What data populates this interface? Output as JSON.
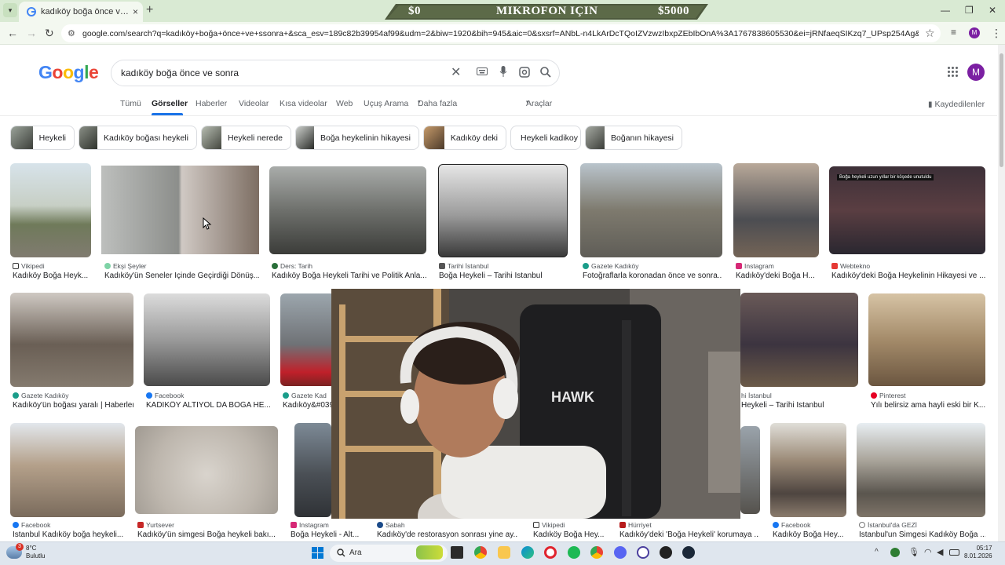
{
  "browser": {
    "tab_title": "kadıköy boğa önce ve sonra - G",
    "tab_close": "×",
    "new_tab": "+",
    "url": "google.com/search?q=kadıköy+boğa+önce+ve+ssonra+&sca_esv=189c82b39954af99&udm=2&biw=1920&bih=945&aic=0&sxsrf=ANbL-n4LkArDcTQoIZVzwzIbxpZEbIbOnA%3A1767838605530&ei=jRNfaeqSIKzq7_UPsp254Ag&ved=0ahUKEwiqjemA8PqR...",
    "profile_initial": "M"
  },
  "banner": {
    "left": "$0",
    "center": "MIKROFON IÇIN",
    "right": "$5000"
  },
  "google": {
    "logo": "Google",
    "query": "kadıköy boğa önce ve sonra",
    "avatar_initial": "M",
    "tabs": [
      "Tümü",
      "Görseller",
      "Haberler",
      "Videolar",
      "Kısa videolar",
      "Web",
      "Uçuş Arama",
      "Daha fazla"
    ],
    "tools": "Araçlar",
    "saved": "Kaydedilenler"
  },
  "chips": [
    "Heykeli",
    "Kadıköy boğası heykeli",
    "Heykeli nerede",
    "Boğa heykelinin hikayesi",
    "Kadıköy deki",
    "Heykeli kadikoy",
    "Boğanın hikayesi"
  ],
  "results": [
    {
      "source": "Vikipedi",
      "title": "Kadıköy Boğa Heyk..."
    },
    {
      "source": "Ekşi Şeyler",
      "title": "Kadıköy'ün Seneler İçinde Geçirdiği Dönüş..."
    },
    {
      "source": "Ders: Tarih",
      "title": "Kadıköy Boğa Heykeli Tarihi ve Politik Anla..."
    },
    {
      "source": "Tarihi İstanbul",
      "title": "Boğa Heykeli – Tarihi İstanbul"
    },
    {
      "source": "Gazete Kadıköy",
      "title": "Fotoğraflarla koronadan önce ve sonra..."
    },
    {
      "source": "Instagram",
      "title": "Kadıköy'deki Boğa H..."
    },
    {
      "source": "Webtekno",
      "title": "Kadıköy'deki Boğa Heykelinin Hikayesi ve ..."
    },
    {
      "source": "Gazete Kadıköy",
      "title": "Kadıköy'ün boğası yaralı | Haberler"
    },
    {
      "source": "Facebook",
      "title": "KADIKÖY ALTIYOL DA BOĞA HE..."
    },
    {
      "source": "Gazete Kad",
      "title": "Kadıköy&#039"
    },
    {
      "source": "hi İstanbul",
      "title": "Heykeli – Tarihi İstanbul"
    },
    {
      "source": "Pinterest",
      "title": "Yılı belirsiz ama hayli eski bir K..."
    },
    {
      "source": "Facebook",
      "title": "İstanbul Kadıköy boğa heykeli..."
    },
    {
      "source": "Yurtsever",
      "title": "Kadıköy'ün simgesi Boğa heykeli bakı..."
    },
    {
      "source": "Instagram",
      "title": "Boğa Heykeli - Alt..."
    },
    {
      "source": "Sabah",
      "title": "Kadıköy'de restorasyon sonrası yine ay..."
    },
    {
      "source": "Vikipedi",
      "title": "Kadıköy Boğa Hey..."
    },
    {
      "source": "Hürriyet",
      "title": "Kadıköy'deki 'Boğa Heykeli' korumaya ..."
    },
    {
      "source": "Facebook",
      "title": "Kadıköy Boğa Hey..."
    },
    {
      "source": "İstanbul'da GEZİ",
      "title": "İstanbul'un Simgesi Kadıköy Boğa ..."
    }
  ],
  "image_caption_text": "Boğa heykeli uzun yıllar bir köşede unutuldu",
  "webcam_shirt": "HAWK",
  "taskbar": {
    "weather_temp": "8°C",
    "weather_desc": "Bulutlu",
    "weather_badge": "3",
    "search_placeholder": "Ara",
    "time": "05:17",
    "date": "8.01.2026"
  }
}
